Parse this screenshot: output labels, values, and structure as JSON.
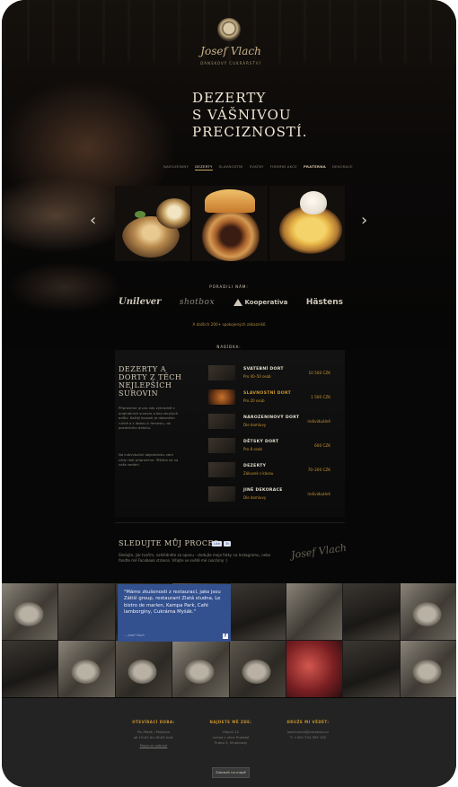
{
  "brand": {
    "name": "Josef Vlach",
    "tagline": "DANSKOVÝ CUKRÁŘSTVÍ"
  },
  "hero": {
    "headline": [
      "DEZERTY",
      "S VÁŠNIVOU",
      "PRECIZNOSTÍ."
    ]
  },
  "nav": {
    "items": [
      "NAROZENINY",
      "DEZERTY",
      "SLAVNOSTNÍ",
      "SVATBY",
      "FIREMNÍ AKCE",
      "PRATERNA",
      "DEKORACE"
    ]
  },
  "slider": {
    "prev": "‹",
    "next": "›"
  },
  "partners": {
    "title": "PORADILI NÁM:",
    "logos": [
      "Unilever",
      "shotbox",
      "Kooperativa",
      "Hästens"
    ],
    "note": "A dalších 200+ spokojených zákazníků"
  },
  "menu": {
    "title": "NABÍDKA:",
    "side_title": [
      "DEZERTY A",
      "DORTY Z TĚCH",
      "NEJLEPŠÍCH",
      "SUROVIN"
    ],
    "side_text": "Připravíme je pro vás výhradně z originálních surovin a bez skrytých aditiv. Každý kousek je dokončen ručně a s láskou k řemeslu, do posledního detailu.",
    "side_text2": "Na individuální objednávku vám vždy rádi připravíme. Těšíme se na vaše zadání.",
    "items": [
      {
        "name": "SVATEBNÍ DORT",
        "sub": "Pro 40–50 osob",
        "price": "10 500 CZK"
      },
      {
        "name": "SLAVNOSTNÍ DORT",
        "sub": "Pro 20 osob",
        "price": "1 500 CZK"
      },
      {
        "name": "NAROZENINOVÝ DORT",
        "sub": "Dle domluvy",
        "price": "Individuálně"
      },
      {
        "name": "DĚTSKÝ DORT",
        "sub": "Pro 8 osob",
        "price": "600 CZK"
      },
      {
        "name": "DEZERTY",
        "sub": "Zákusek s kávou",
        "price": "70–200 CZK"
      },
      {
        "name": "JINÉ DEKORACE",
        "sub": "Dle domluvy",
        "price": "Individuálně"
      }
    ]
  },
  "follow": {
    "title": "SLEDUJTE MŮJ PROCES",
    "like": "Like",
    "count": "3k",
    "text": "Sledujte, jak tvořím, nahlédněte za oponu - sledujte moje fotky na Instagramu, nebo fandte mé Facebook stránce. Vítejte ve světě mé cukrárny :)",
    "signature": "Josef Vlach"
  },
  "quote": {
    "text": "\"Máme zkušenosti z restaurací, jako jsou Zátiší group, restaurant Zlatá studna, Le bistro de marlen, Kampa Park, Café lamborginy, Cukrárna Myšák.\"",
    "author": "— Josef Vlach",
    "fb": "f"
  },
  "footer": {
    "columns": [
      {
        "head": "OTEVÍRACÍ DOBA:",
        "lines": [
          "Po–Pátek / Pekárna",
          "od 10:00 do 18:00 hod."
        ],
        "link": "Mapa se zobrazí"
      },
      {
        "head": "NAJDETE MĚ ZDE:",
        "lines": [
          "Hlavní 12",
          "vchod z ulice Pražské",
          "Praha 3, Vinohrady"
        ],
        "link": ""
      },
      {
        "head": "DRUŽE MI VĚDĚT:",
        "lines": [
          "josef.vlach@cukrarna.cz",
          "T: +420 724 395 150"
        ],
        "link": ""
      }
    ],
    "button": "Zobrazit na mapě"
  },
  "colors": {
    "accent_gold": "#c9952f",
    "quote_bg": "#33508f",
    "footer_bg": "#232323"
  }
}
